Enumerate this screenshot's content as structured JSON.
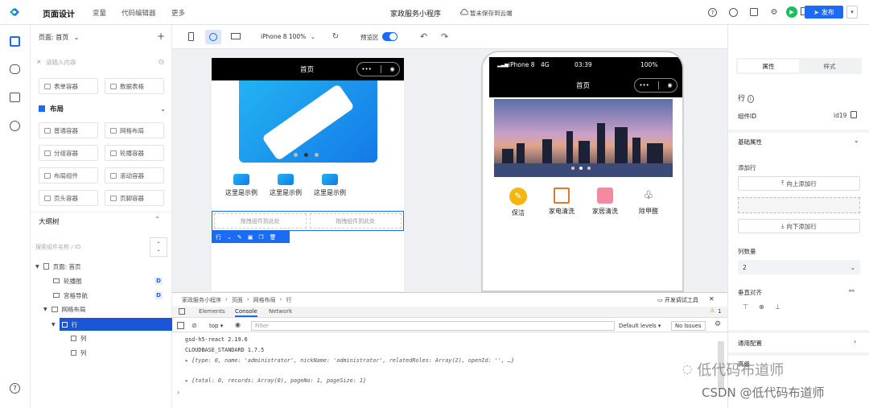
{
  "top": {
    "title": "页面设计",
    "menu": [
      "变量",
      "代码编辑器",
      "更多"
    ],
    "app_name": "家政服务小程序",
    "save_status": "暂未保存到云端",
    "publish_label": "发布"
  },
  "left": {
    "page_label": "页面: 首页",
    "components_row1": [
      "表单容器",
      "数据表格"
    ],
    "layout_group": "布局",
    "components": [
      "普通容器",
      "网格布局",
      "分组容器",
      "轮播容器",
      "布局组件",
      "滚动容器",
      "页头容器",
      "页脚容器"
    ],
    "outline_title": "大纲树",
    "search_placeholder": "搜索组件名称 / ID",
    "tree": [
      {
        "label": "页面: 首页",
        "badge": ""
      },
      {
        "label": "轮播图",
        "badge": "D"
      },
      {
        "label": "宫格导航",
        "badge": "D"
      },
      {
        "label": "网格布局",
        "badge": ""
      },
      {
        "label": "行",
        "badge": ""
      },
      {
        "label": "列",
        "badge": ""
      },
      {
        "label": "列",
        "badge": ""
      }
    ],
    "search_placeholder_top": "请输入内容"
  },
  "toolbar": {
    "device": "iPhone 8 100%",
    "preview_label": "预览区",
    "preview_on": true
  },
  "editor_phone": {
    "title": "首页",
    "nav": [
      "这里是示例",
      "这里是示例",
      "这里是示例"
    ],
    "drop_hint": [
      "拖拽组件到此处",
      "拖拽组件到此处"
    ],
    "row_tag": "行"
  },
  "preview_phone": {
    "carrier": "iPhone 8",
    "network": "4G",
    "time": "03:39",
    "battery": "100%",
    "title": "首页",
    "services": [
      "保洁",
      "家电清洗",
      "家居清洗",
      "除甲醛"
    ]
  },
  "right": {
    "tabs": [
      "属性",
      "样式"
    ],
    "component_name": "行",
    "component_id_label": "组件ID",
    "component_id": "id19",
    "basic_props": "基础属性",
    "add_row": "添加行",
    "add_above": "向上添加行",
    "add_below": "向下添加行",
    "col_count_label": "列数量",
    "col_count": "2",
    "valign_label": "垂直对齐",
    "common_config": "通用配置",
    "advanced": "高级"
  },
  "devtools": {
    "breadcrumb": [
      "家政服务小程序",
      "页面",
      "网格布局",
      "行"
    ],
    "open_tools": "开发调试工具",
    "tabs": [
      "Elements",
      "Console",
      "Network"
    ],
    "context": "top",
    "filter_placeholder": "Filter",
    "levels": "Default levels",
    "no_issues": "No Issues",
    "warn_count": "1",
    "lines": [
      "gsd-h5-react 2.19.6",
      "CLOUDBASE_STANDARD 1.7.5",
      "▸ {type: 0, name: 'administrator', nickName: 'administrator', relatedRoles: Array(2), openId: '', …}",
      "▸ {total: 0, records: Array(0), pageNo: 1, pageSize: 1}"
    ]
  },
  "watermark": {
    "wechat": "低代码布道师",
    "csdn": "CSDN @低代码布道师"
  },
  "colors": {
    "accent": "#1a6cf5",
    "green": "#1bbf5f"
  }
}
